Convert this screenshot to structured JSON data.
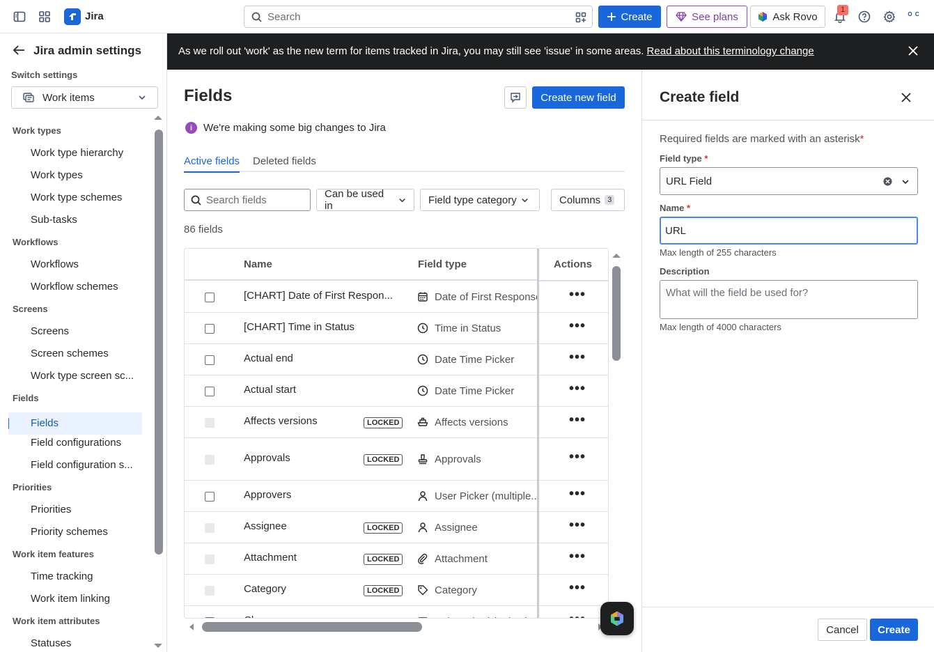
{
  "topnav": {
    "app_name": "Jira",
    "search_placeholder": "Search",
    "create_label": "Create",
    "see_plans_label": "See plans",
    "ask_rovo_label": "Ask Rovo",
    "notification_count": "1",
    "avatar_initials": "O C",
    "icons": [
      "sidebar-toggle-icon",
      "app-switcher-icon",
      "search-icon",
      "filter-icon",
      "plus-icon",
      "diamond-icon",
      "rovo-icon",
      "bell-icon",
      "help-icon",
      "gear-icon"
    ]
  },
  "sidebar": {
    "title": "Jira admin settings",
    "switch_label": "Switch settings",
    "switch_value": "Work items",
    "sections": [
      {
        "heading": "Work types",
        "items": [
          "Work type hierarchy",
          "Work types",
          "Work type schemes",
          "Sub-tasks"
        ]
      },
      {
        "heading": "Workflows",
        "items": [
          "Workflows",
          "Workflow schemes"
        ]
      },
      {
        "heading": "Screens",
        "items": [
          "Screens",
          "Screen schemes",
          "Work type screen sc..."
        ]
      },
      {
        "heading": "Fields",
        "items": [
          "Fields",
          "Field configurations",
          "Field configuration s..."
        ]
      },
      {
        "heading": "Priorities",
        "items": [
          "Priorities",
          "Priority schemes"
        ]
      },
      {
        "heading": "Work item features",
        "items": [
          "Time tracking",
          "Work item linking"
        ]
      },
      {
        "heading": "Work item attributes",
        "items": [
          "Statuses"
        ]
      }
    ],
    "active_item": "Fields"
  },
  "banner": {
    "text": "As we roll out 'work' as the new term for items tracked in Jira, you may still see 'issue' in some areas. ",
    "link": "Read about this terminology change"
  },
  "main": {
    "title": "Fields",
    "create_button": "Create new field",
    "info_icon": "i",
    "info_text": "We're making some big changes to Jira",
    "tabs": [
      "Active fields",
      "Deleted fields"
    ],
    "search_placeholder": "Search fields",
    "filters": [
      "Can be used in",
      "Field type category",
      "Columns"
    ],
    "columns_count": "3",
    "fields_count": "86 fields",
    "table": {
      "headers": [
        "Name",
        "Field type",
        "Actions"
      ],
      "rows": [
        {
          "name": "[CHART] Date of First Respon...",
          "type": "Date of First Response",
          "icon": "calendar-icon",
          "locked": false
        },
        {
          "name": "[CHART] Time in Status",
          "type": "Time in Status",
          "icon": "clock-icon",
          "locked": false
        },
        {
          "name": "Actual end",
          "type": "Date Time Picker",
          "icon": "clock-icon",
          "locked": false
        },
        {
          "name": "Actual start",
          "type": "Date Time Picker",
          "icon": "clock-icon",
          "locked": false
        },
        {
          "name": "Affects versions",
          "type": "Affects versions",
          "icon": "ship-icon",
          "locked": true
        },
        {
          "name": "Approvals",
          "type": "Approvals",
          "icon": "stamp-icon",
          "locked": true
        },
        {
          "name": "Approvers",
          "type": "User Picker (multiple...",
          "icon": "person-icon",
          "locked": false
        },
        {
          "name": "Assignee",
          "type": "Assignee",
          "icon": "person-icon",
          "locked": true
        },
        {
          "name": "Attachment",
          "type": "Attachment",
          "icon": "paperclip-icon",
          "locked": true
        },
        {
          "name": "Category",
          "type": "Category",
          "icon": "tag-icon",
          "locked": true
        },
        {
          "name": "Change reason",
          "type": "Select List (single ch...",
          "icon": "list-icon",
          "locked": false
        }
      ],
      "locked_label": "LOCKED",
      "actions_label": "•••"
    }
  },
  "panel": {
    "title": "Create field",
    "required_note": "Required fields are marked with an asterisk",
    "asterisk": "*",
    "field_type_label": "Field type",
    "field_type_value": "URL Field",
    "name_label": "Name",
    "name_value": "URL",
    "name_helper": "Max length of 255 characters",
    "description_label": "Description",
    "description_placeholder": "What will the field be used for?",
    "description_helper": "Max length of 4000 characters",
    "cancel_label": "Cancel",
    "create_label": "Create"
  },
  "colors": {
    "brand_blue": "#1868db",
    "banner_bg": "#1e1f21",
    "active_nav_bg": "#e9f2fe",
    "plans_purple": "#964ac0"
  }
}
